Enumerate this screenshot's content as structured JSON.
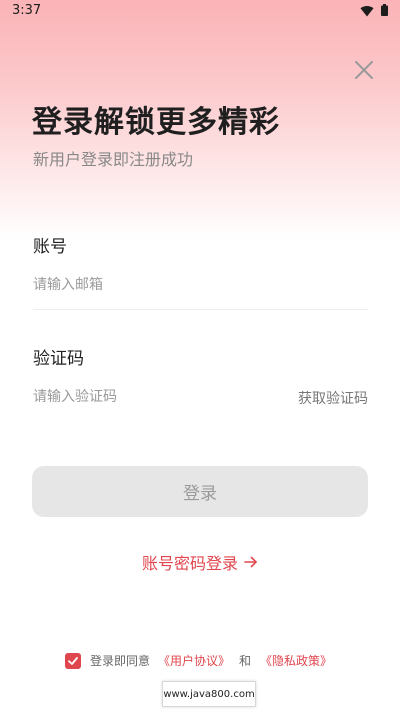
{
  "status_bar": {
    "time": "3:37",
    "wifi_icon": "wifi-icon",
    "battery_icon": "battery-icon"
  },
  "header": {
    "close_icon": "close-icon",
    "title": "登录解锁更多精彩",
    "subtitle": "新用户登录即注册成功"
  },
  "form": {
    "account_label": "账号",
    "account_placeholder": "请输入邮箱",
    "account_value": "",
    "code_label": "验证码",
    "code_placeholder": "请输入验证码",
    "code_value": "",
    "get_code_label": "获取验证码"
  },
  "login_button_label": "登录",
  "password_login_link": "账号密码登录",
  "agreement": {
    "checked": true,
    "prefix": "登录即同意",
    "user_agreement": "《用户协议》",
    "and": "和",
    "privacy_policy": "《隐私政策》"
  },
  "watermark": "www.java800.com",
  "colors": {
    "accent": "#e0464e",
    "button_disabled_bg": "#e6e6e6",
    "header_gradient_top": "#fbb3b7"
  }
}
